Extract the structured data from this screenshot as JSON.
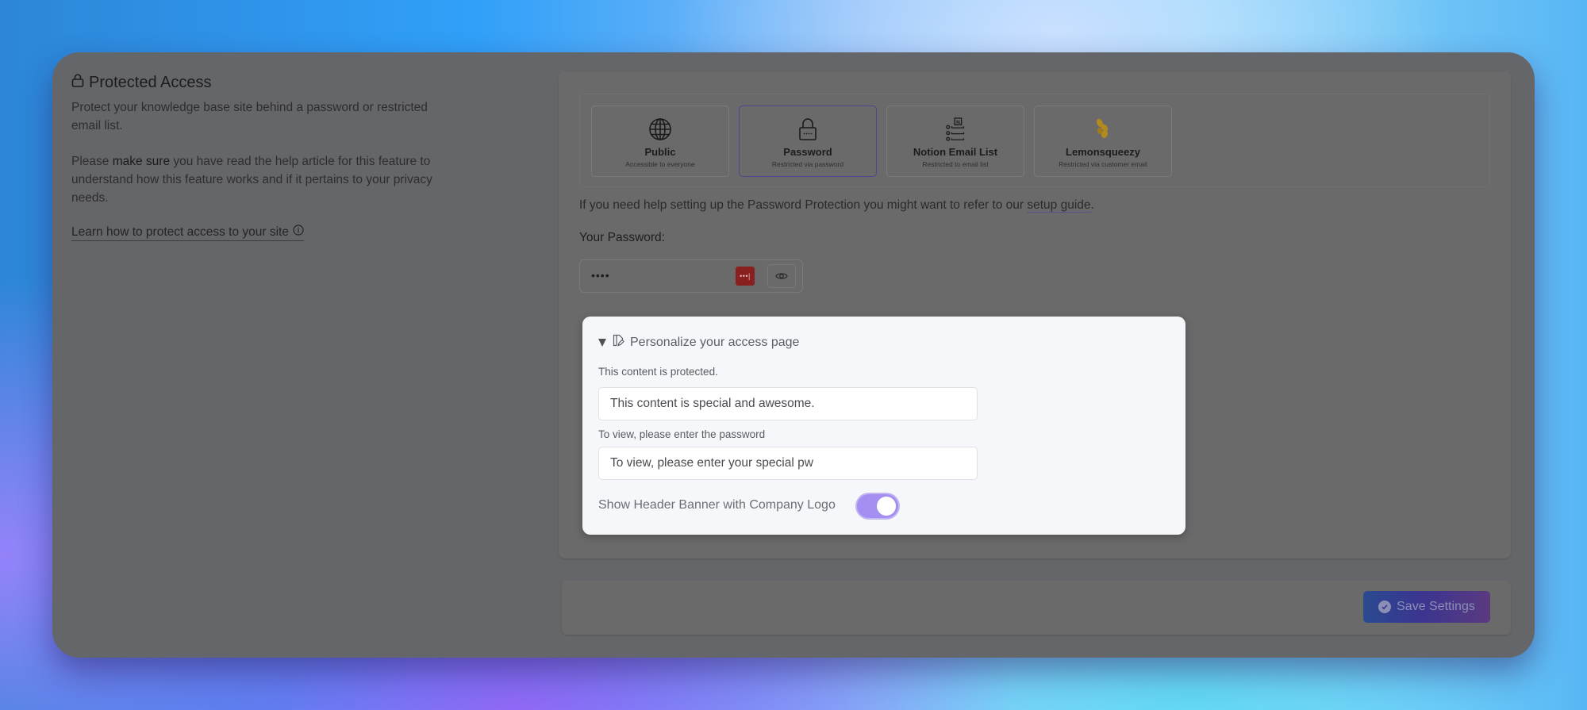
{
  "section": {
    "title": "Protected Access",
    "title_icon": "lock-icon",
    "description": "Protect your knowledge base site behind a password or restricted email list.",
    "help_pre": "Please ",
    "help_bold": "make sure",
    "help_post": " you have read the help article for this feature to understand how this feature works and if it pertains to your privacy needs.",
    "learn_link": "Learn how to protect access to your site",
    "learn_icon": "info-circle-icon"
  },
  "access_options": [
    {
      "name": "Public",
      "subtitle": "Accessible to everyone",
      "icon": "globe-icon",
      "selected": false
    },
    {
      "name": "Password",
      "subtitle": "Restricted via password",
      "icon": "padlock-icon",
      "selected": true
    },
    {
      "name": "Notion Email List",
      "subtitle": "Restricted to email list",
      "icon": "notion-list-icon",
      "selected": false
    },
    {
      "name": "Lemonsqueezy",
      "subtitle": "Restricted via customer email",
      "icon": "lemonsqueezy-icon",
      "selected": false
    }
  ],
  "help_text": {
    "before": "If you need help setting up the Password Protection you might want to refer to our ",
    "link": "setup guide",
    "after": "."
  },
  "password": {
    "label": "Your Password:",
    "value": "••••",
    "badge_text": "•••|",
    "badge_color": "#8a1f1f"
  },
  "personalize": {
    "summary": "Personalize your access page",
    "expanded": true,
    "field1_label": "This content is protected.",
    "field1_value": "This content is special and awesome.",
    "field2_label": "To view, please enter the password",
    "field2_value": "To view, please enter your special pw",
    "toggle_label": "Show Header Banner with Company Logo",
    "toggle_on": true,
    "toggle_color": "#a58ef2"
  },
  "footer": {
    "save_label": "Save Settings"
  }
}
